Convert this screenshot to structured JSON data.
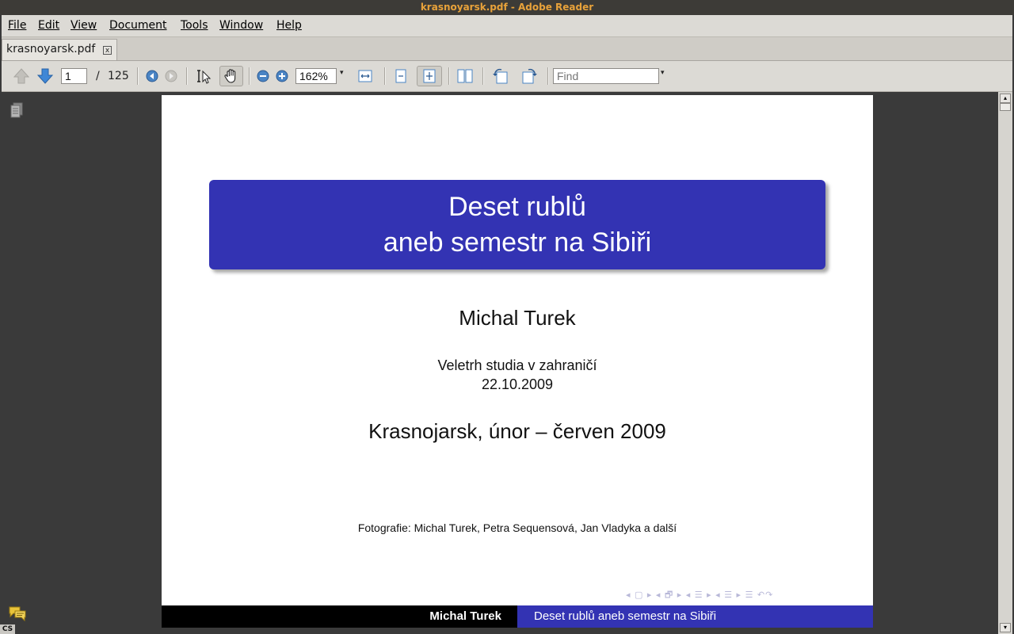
{
  "window": {
    "title": "krasnoyarsk.pdf - Adobe Reader"
  },
  "menu": [
    "File",
    "Edit",
    "View",
    "Document",
    "Tools",
    "Window",
    "Help"
  ],
  "tab": {
    "label": "krasnoyarsk.pdf",
    "close_glyph": "x"
  },
  "toolbar": {
    "page_current": "1",
    "page_separator": "/",
    "page_total": "125",
    "zoom": "162%",
    "find_placeholder": "Find"
  },
  "document": {
    "title_line1": "Deset rublů",
    "title_line2": "aneb semestr na Sibiři",
    "author": "Michal Turek",
    "event": "Veletrh studia v zahraničí",
    "date": "22.10.2009",
    "subtitle": "Krasnojarsk, únor – červen 2009",
    "photos": "Fotografie: Michal Turek, Petra Sequensová, Jan Vladyka a další",
    "footer_author": "Michal Turek",
    "footer_title": "Deset rublů aneb semestr na Sibiři",
    "nav_symbols": "◂ ▢ ▸ ◂ 🗗 ▸ ◂ ☰ ▸ ◂ ☰ ▸ ☰ ↶↷"
  },
  "statusbar": {
    "input_language": "CS"
  },
  "colors": {
    "beamer_blue": "#3333b3",
    "title_accent": "#e8a23a"
  }
}
